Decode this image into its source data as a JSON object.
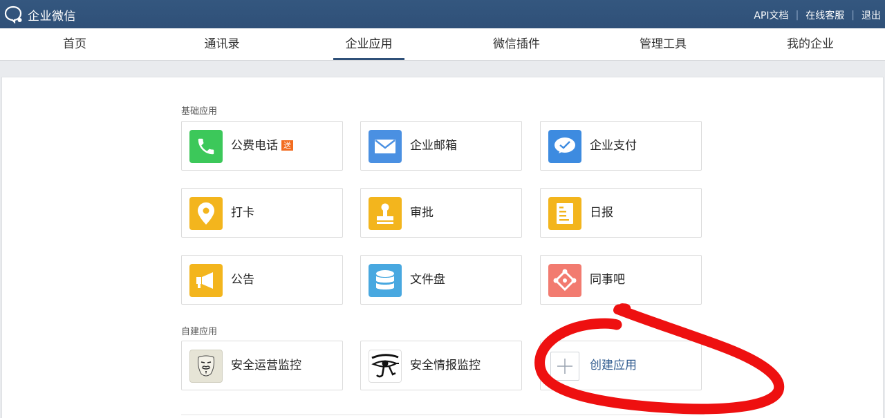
{
  "header": {
    "logo_text": "企业微信",
    "links": [
      "API文档",
      "在线客服",
      "退出"
    ]
  },
  "nav": {
    "tabs": [
      {
        "label": "首页",
        "active": false
      },
      {
        "label": "通讯录",
        "active": false
      },
      {
        "label": "企业应用",
        "active": true
      },
      {
        "label": "微信插件",
        "active": false
      },
      {
        "label": "管理工具",
        "active": false
      },
      {
        "label": "我的企业",
        "active": false
      }
    ]
  },
  "sections": {
    "basic": {
      "title": "基础应用",
      "apps": [
        {
          "label": "公费电话",
          "badge": "送",
          "icon": "phone-icon",
          "color": "#3cc85a"
        },
        {
          "label": "企业邮箱",
          "icon": "mail-icon",
          "color": "#4a90e2"
        },
        {
          "label": "企业支付",
          "icon": "pay-icon",
          "color": "#3d8be0"
        },
        {
          "label": "打卡",
          "icon": "location-pin-icon",
          "color": "#f3b51d"
        },
        {
          "label": "审批",
          "icon": "stamp-icon",
          "color": "#f3b51d"
        },
        {
          "label": "日报",
          "icon": "document-icon",
          "color": "#f3b51d"
        },
        {
          "label": "公告",
          "icon": "megaphone-icon",
          "color": "#f3b51d"
        },
        {
          "label": "文件盘",
          "icon": "database-icon",
          "color": "#48a8e0"
        },
        {
          "label": "同事吧",
          "icon": "community-icon",
          "color": "#f27b70"
        }
      ]
    },
    "custom": {
      "title": "自建应用",
      "apps": [
        {
          "label": "安全运营监控",
          "icon": "mask-face-icon"
        },
        {
          "label": "安全情报监控",
          "icon": "eye-of-horus-icon"
        },
        {
          "label": "创建应用",
          "icon": "plus-icon"
        }
      ]
    }
  },
  "annotation": {
    "color": "#ee0000"
  }
}
